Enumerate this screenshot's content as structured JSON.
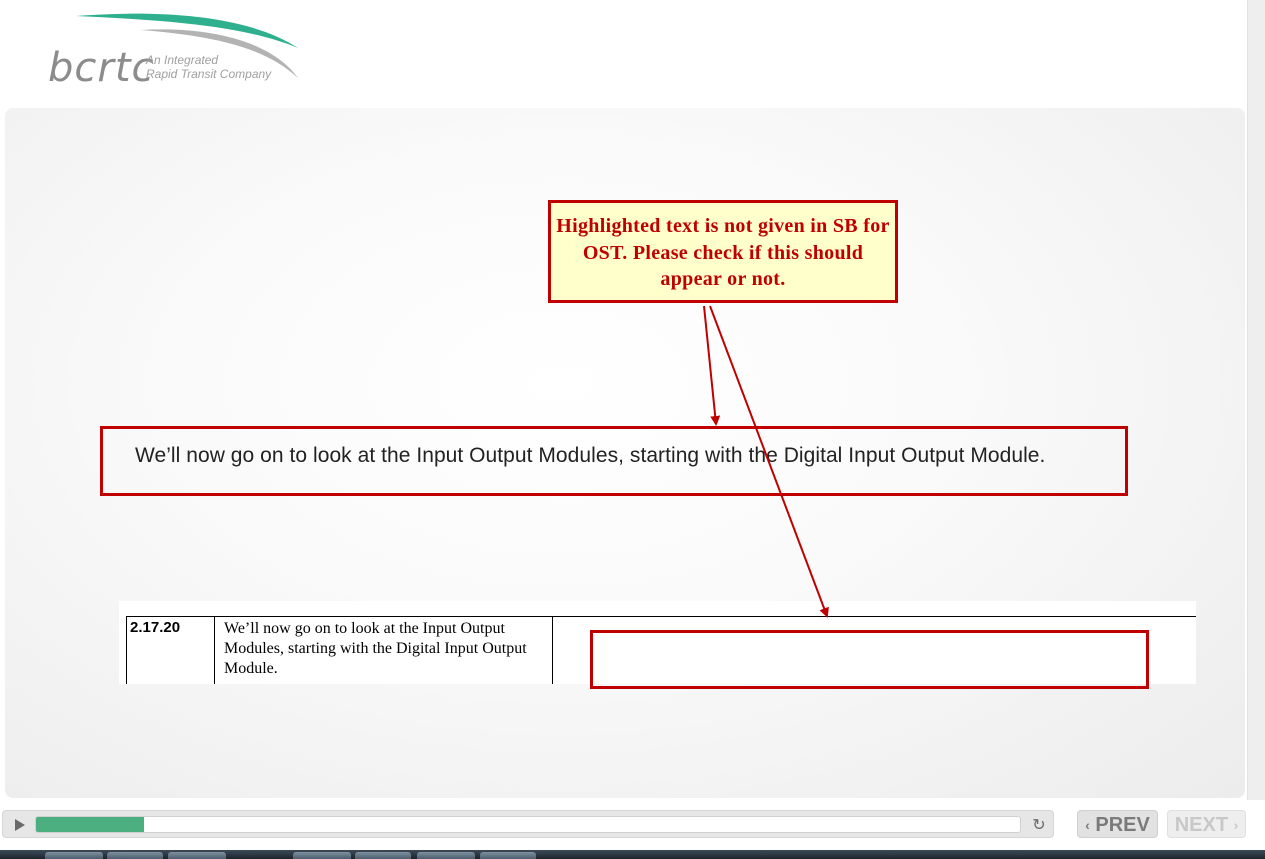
{
  "logo": {
    "wordmark": "bcrtc",
    "tagline_line1": "An Integrated",
    "tagline_line2": "Rapid Transit Company",
    "swoosh_colors": [
      "#2eb08e",
      "#b0b0b0"
    ]
  },
  "callout": {
    "text": "Highlighted text is not given in SB for OST. Please check if this should appear or not."
  },
  "slide": {
    "narration": "We’ll now go on to look at the Input Output Modules, starting with the Digital Input Output Module."
  },
  "table_snippet": {
    "id": "2.17.20",
    "text": "We’ll now go on to look at the Input Output Modules, starting with the Digital Input Output Module."
  },
  "player": {
    "progress_fraction": 0.11,
    "prev_label": "PREV",
    "next_label": "NEXT",
    "play_icon": "play-icon",
    "replay_icon": "replay-icon"
  },
  "colors": {
    "annotation_red": "#c00000",
    "callout_fill": "#ffffcc",
    "progress_green": "#4caf7f"
  }
}
